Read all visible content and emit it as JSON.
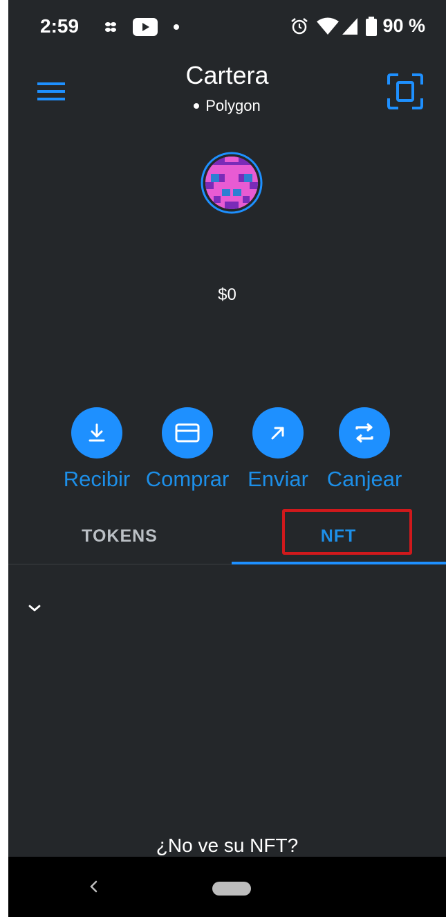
{
  "status_bar": {
    "time": "2:59",
    "battery": "90 %",
    "left_icons": [
      "pinwheel-icon",
      "youtube-icon",
      "notification-dot-icon"
    ],
    "right_icons": [
      "alarm-icon",
      "wifi-icon",
      "cell-signal-icon",
      "battery-icon"
    ]
  },
  "header": {
    "title": "Cartera",
    "network": "Polygon",
    "menu_icon": "hamburger-menu-icon",
    "scan_icon": "qr-scan-icon"
  },
  "account": {
    "balance": "$0",
    "avatar_colors": {
      "ring": "#1e90ff",
      "primary": "#e85bd3",
      "secondary": "#7a2bb8",
      "accent": "#2d7fd2"
    }
  },
  "actions": [
    {
      "label": "Recibir",
      "icon": "download-icon"
    },
    {
      "label": "Comprar",
      "icon": "card-icon"
    },
    {
      "label": "Enviar",
      "icon": "arrow-up-right-icon"
    },
    {
      "label": "Canjear",
      "icon": "swap-icon"
    }
  ],
  "tabs": [
    {
      "label": "TOKENS",
      "selected": false
    },
    {
      "label": "NFT",
      "selected": true
    }
  ],
  "nft_section": {
    "collapse_icon": "chevron-down-icon",
    "missing_nft_link": "¿No ve su NFT?"
  },
  "colors": {
    "background": "#24272a",
    "accent": "#1e90ff",
    "highlight": "#d0191c",
    "tab_inactive": "#bbc0c5"
  }
}
